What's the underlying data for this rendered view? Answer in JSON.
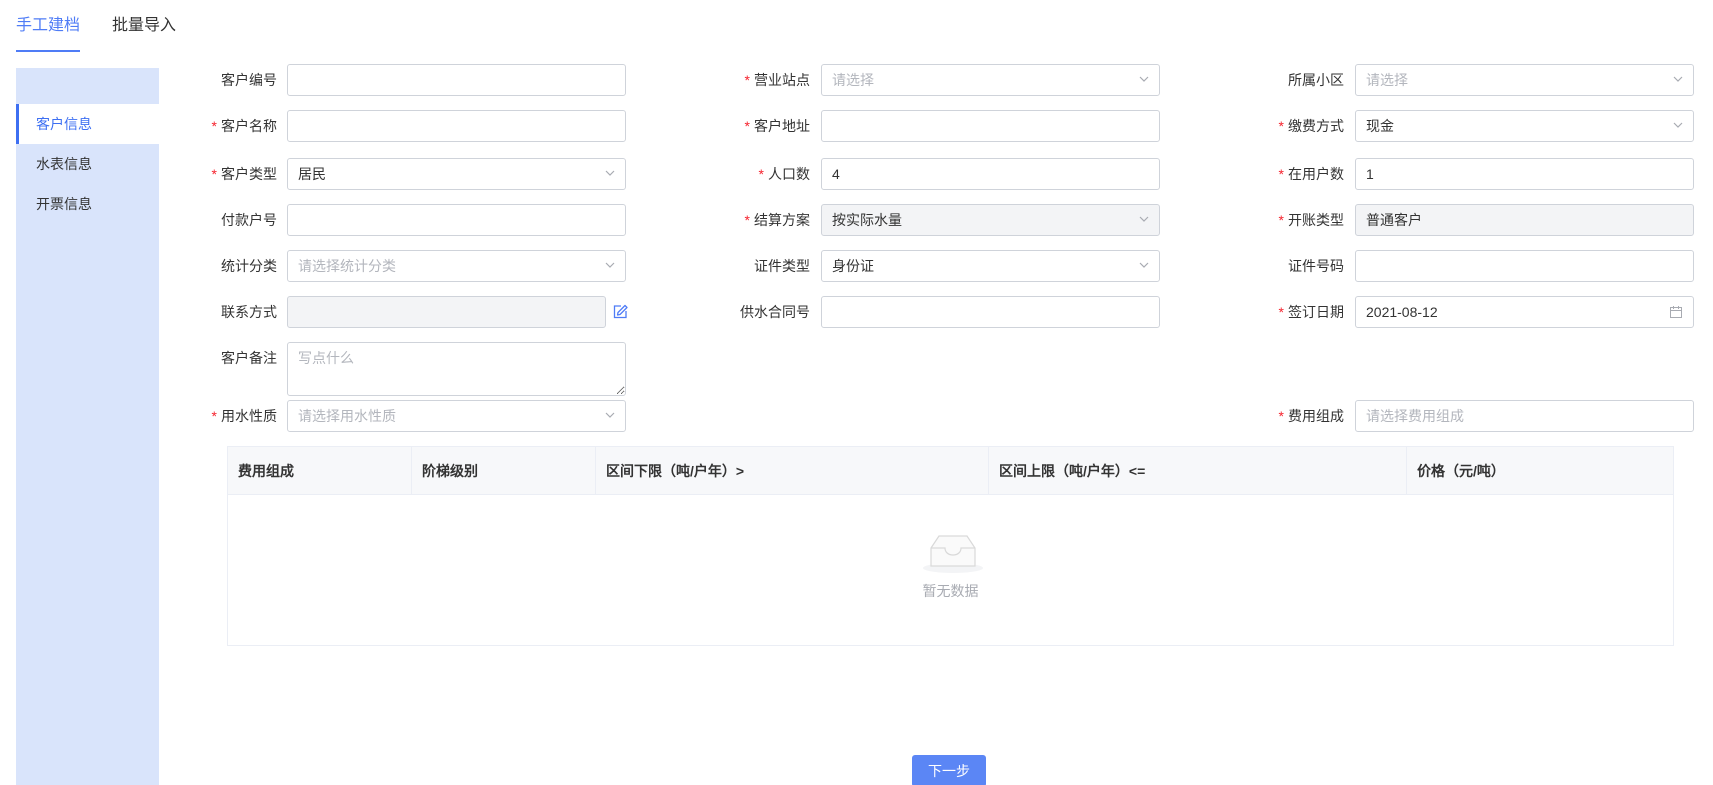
{
  "top_tabs": [
    {
      "label": "手工建档",
      "active": true
    },
    {
      "label": "批量导入",
      "active": false
    }
  ],
  "sidebar": {
    "items": [
      {
        "label": "客户信息",
        "active": true
      },
      {
        "label": "水表信息",
        "active": false
      },
      {
        "label": "开票信息",
        "active": false
      }
    ]
  },
  "form": {
    "customer_no": {
      "label": "客户编号",
      "required": false,
      "value": ""
    },
    "business_station": {
      "label": "营业站点",
      "required": true,
      "placeholder": "请选择"
    },
    "community": {
      "label": "所属小区",
      "required": false,
      "placeholder": "请选择"
    },
    "customer_name": {
      "label": "客户名称",
      "required": true,
      "value": ""
    },
    "customer_address": {
      "label": "客户地址",
      "required": true,
      "value": ""
    },
    "payment_method": {
      "label": "缴费方式",
      "required": true,
      "value": "现金"
    },
    "customer_type": {
      "label": "客户类型",
      "required": true,
      "value": "居民"
    },
    "population": {
      "label": "人口数",
      "required": true,
      "value": "4"
    },
    "household_count": {
      "label": "在用户数",
      "required": true,
      "value": "1"
    },
    "payer_no": {
      "label": "付款户号",
      "required": false,
      "value": ""
    },
    "settlement_plan": {
      "label": "结算方案",
      "required": true,
      "value": "按实际水量"
    },
    "account_type": {
      "label": "开账类型",
      "required": true,
      "value": "普通客户"
    },
    "stat_category": {
      "label": "统计分类",
      "required": false,
      "placeholder": "请选择统计分类"
    },
    "id_type": {
      "label": "证件类型",
      "required": false,
      "value": "身份证"
    },
    "id_number": {
      "label": "证件号码",
      "required": false,
      "value": ""
    },
    "contact": {
      "label": "联系方式",
      "required": false,
      "value": ""
    },
    "supply_contract_no": {
      "label": "供水合同号",
      "required": false,
      "value": ""
    },
    "sign_date": {
      "label": "签订日期",
      "required": true,
      "value": "2021-08-12"
    },
    "remarks": {
      "label": "客户备注",
      "required": false,
      "placeholder": "写点什么"
    },
    "water_nature": {
      "label": "用水性质",
      "required": true,
      "placeholder": "请选择用水性质"
    },
    "fee_composition": {
      "label": "费用组成",
      "required": true,
      "placeholder": "请选择费用组成"
    }
  },
  "table": {
    "columns": [
      "费用组成",
      "阶梯级别",
      "区间下限（吨/户年）>",
      "区间上限（吨/户年）<=",
      "价格（元/吨）"
    ],
    "rows": [],
    "empty_text": "暂无数据"
  },
  "actions": {
    "next_label": "下一步"
  },
  "colors": {
    "accent": "#4f7cf6",
    "sidebar_bg": "#d9e4fb",
    "required": "#f5222d",
    "button": "#5b86f5"
  }
}
